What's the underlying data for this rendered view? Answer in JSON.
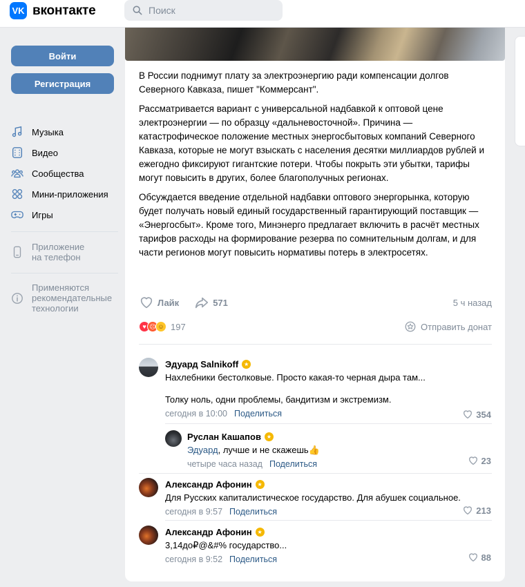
{
  "header": {
    "logo_badge": "VK",
    "logo_text": "вконтакте",
    "search_placeholder": "Поиск"
  },
  "sidebar": {
    "login_label": "Войти",
    "register_label": "Регистрация",
    "items": [
      {
        "label": "Музыка",
        "icon": "music-icon"
      },
      {
        "label": "Видео",
        "icon": "video-icon"
      },
      {
        "label": "Сообщества",
        "icon": "communities-icon"
      },
      {
        "label": "Мини-приложения",
        "icon": "apps-icon"
      },
      {
        "label": "Игры",
        "icon": "games-icon"
      }
    ],
    "phone_app": {
      "line1": "Приложение",
      "line2": "на телефон"
    },
    "recommend": {
      "line1": "Применяются",
      "line2": "рекомендательные",
      "line3": "технологии"
    }
  },
  "post": {
    "paragraphs": [
      "В России поднимут плату за электроэнергию ради компенсации долгов Северного Кавказа, пишет \"Коммерсант\".",
      "Рассматривается вариант с универсальной надбавкой к оптовой цене электроэнергии — по образцу «дальневосточной». Причина — катастрофическое положение местных энергосбытовых компаний Северного Кавказа, которые не могут взыскать с населения десятки миллиардов рублей и ежегодно фиксируют гигантские потери. Чтобы покрыть эти убытки, тарифы могут повысить в других, более благополучных регионах.",
      "Обсуждается введение отдельной надбавки оптового энергорынка, которую будет получать новый единый государственный гарантирующий поставщик — «Энергосбыт». Кроме того, Минэнерго предлагает включить в расчёт местных тарифов расходы на формирование резерва по сомнительным долгам, и для части регионов могут повысить нормативы потерь в электросетях."
    ],
    "like_label": "Лайк",
    "share_count": "571",
    "time": "5 ч назад",
    "reactions_count": "197",
    "donate_label": "Отправить донат"
  },
  "comments": [
    {
      "author": "Эдуард Salnikoff",
      "line1": "Нахлебники бестолковые. Просто какая-то черная дыра там...",
      "line2": "Толку ноль, одни проблемы, бандитизм и экстремизм.",
      "time": "сегодня в 10:00",
      "share": "Поделиться",
      "likes": "354"
    },
    {
      "author": "Руслан Кашапов",
      "mention": "Эдуард",
      "text": ", лучше и не скажешь👍",
      "time": "четыре часа назад",
      "share": "Поделиться",
      "likes": "23"
    },
    {
      "author": "Александр Афонин",
      "text": "Для Русских капиталистическое государство. Для абушек социальное.",
      "time": "сегодня в 9:57",
      "share": "Поделиться",
      "likes": "213"
    },
    {
      "author": "Александр Афонин",
      "text": "3,14до₽@&#% государство...",
      "time": "сегодня в 9:52",
      "share": "Поделиться",
      "likes": "88"
    }
  ]
}
